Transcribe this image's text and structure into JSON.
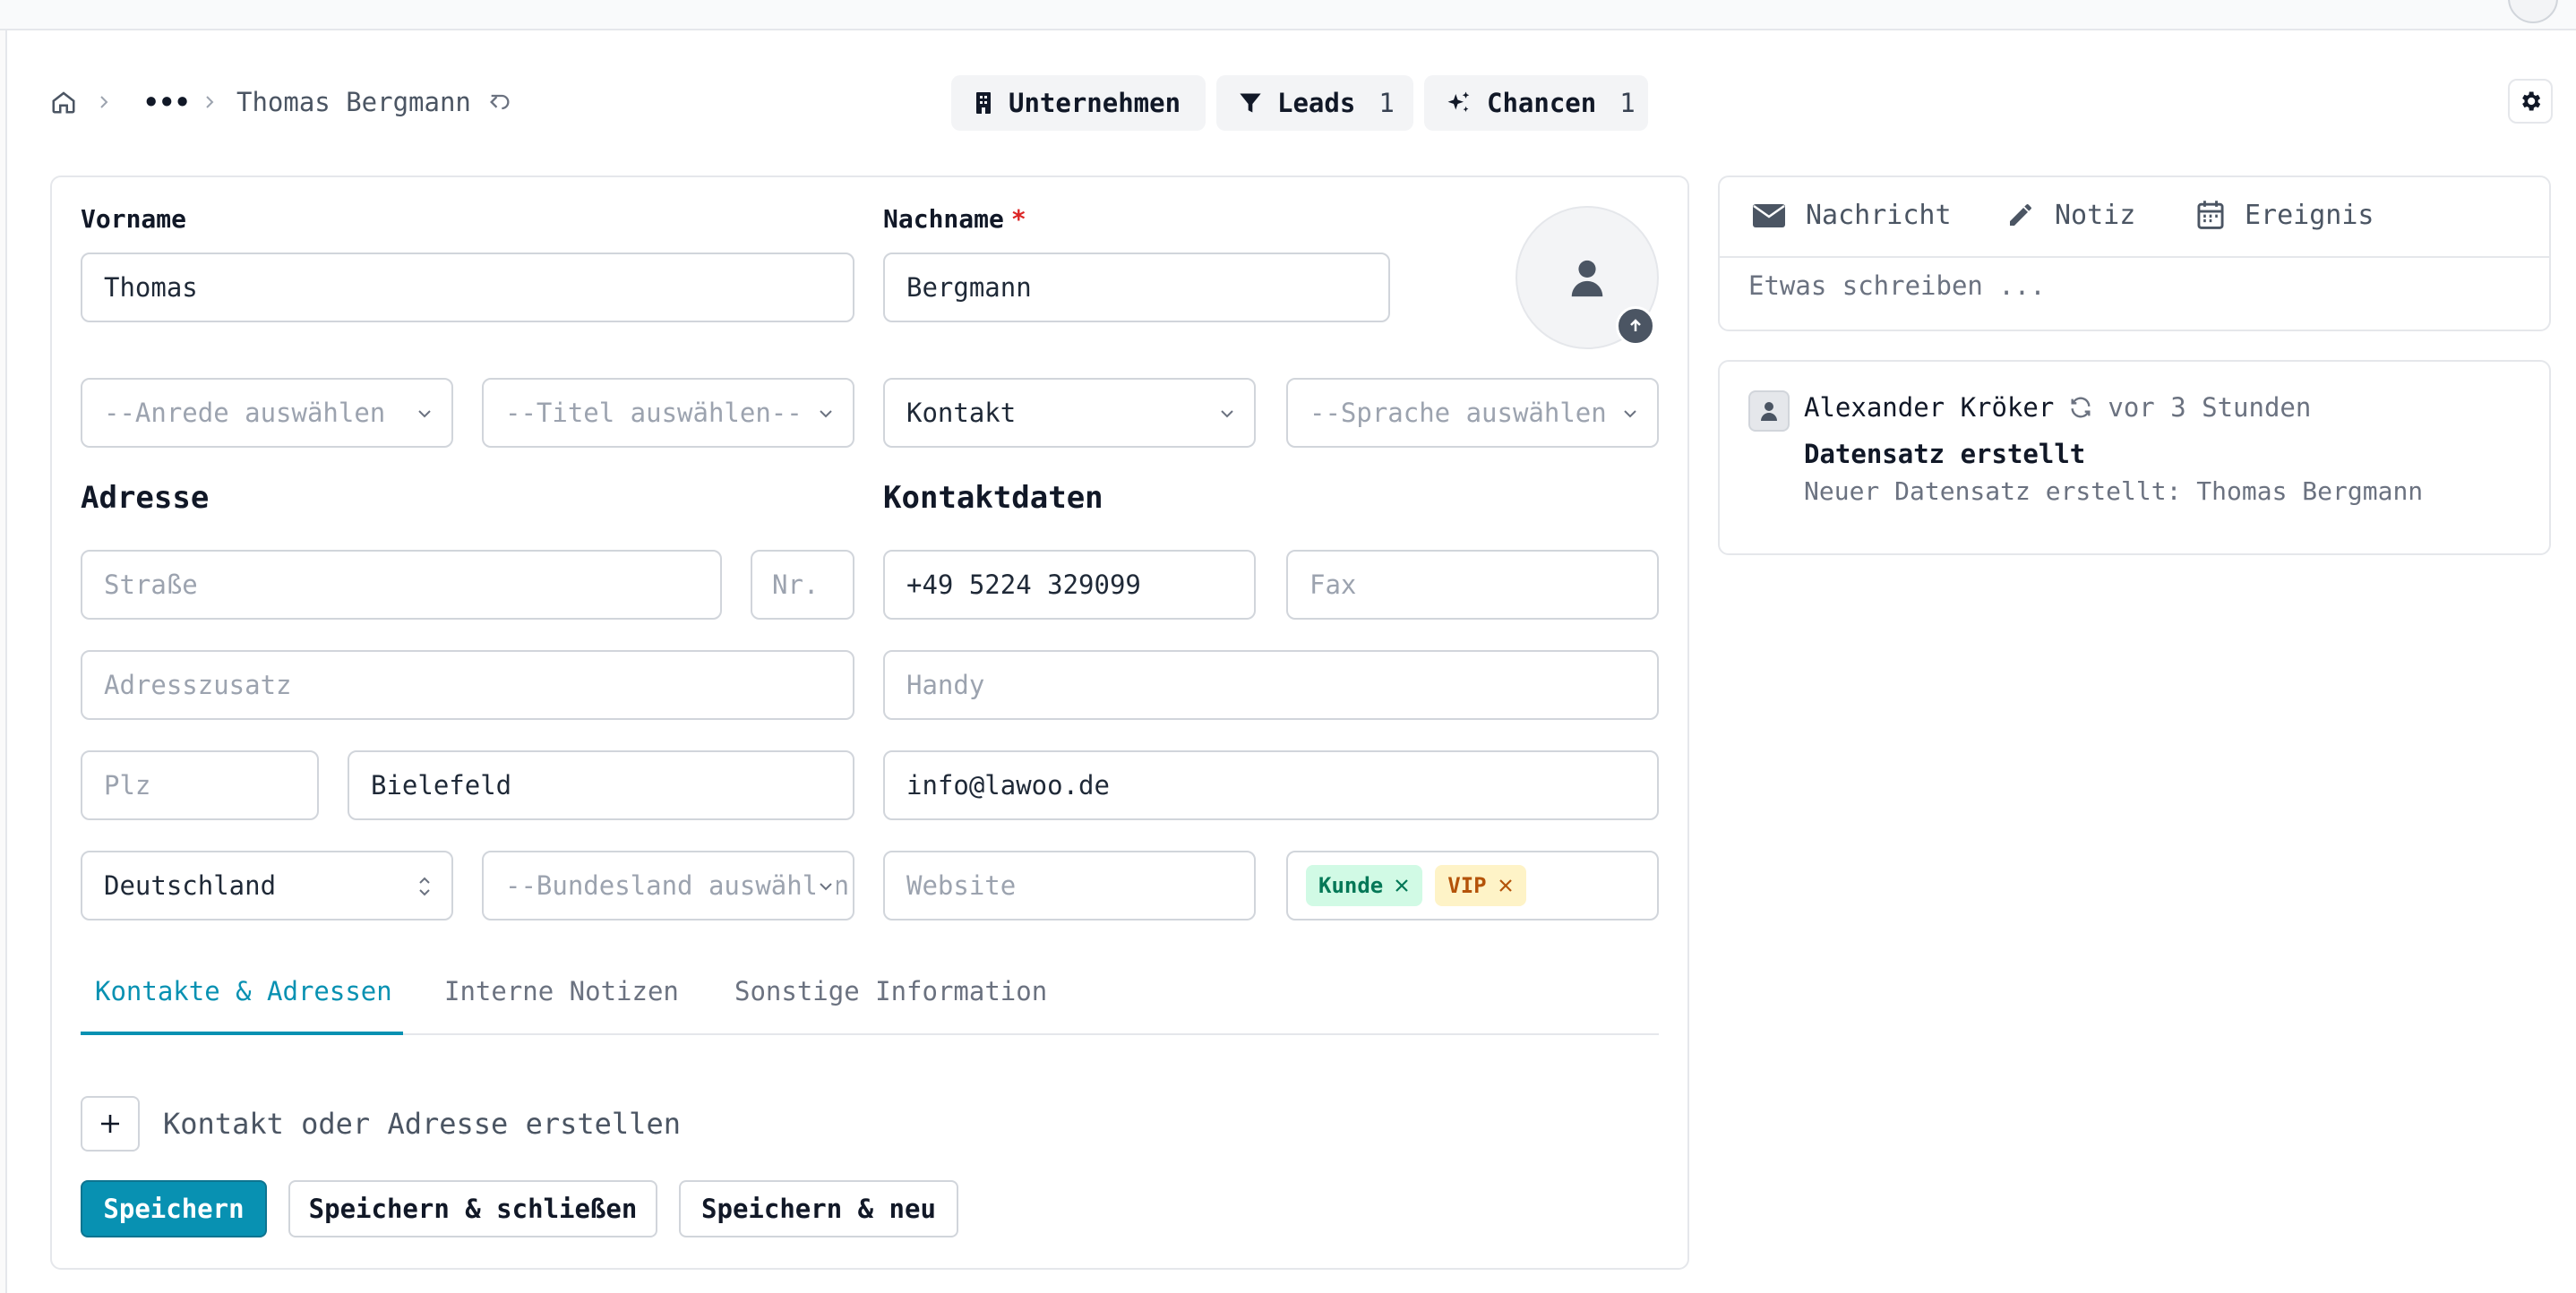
{
  "breadcrumb": {
    "more_label": "•••",
    "record_name": "Thomas Bergmann"
  },
  "top_actions": [
    {
      "label": "Unternehmen",
      "icon": "building-icon"
    },
    {
      "label": "Leads",
      "count": "1",
      "icon": "funnel-icon"
    },
    {
      "label": "Chancen",
      "count": "1",
      "icon": "sparkles-icon"
    }
  ],
  "form": {
    "first_name": {
      "label": "Vorname",
      "value": "Thomas"
    },
    "last_name": {
      "label": "Nachname",
      "required_mark": "*",
      "value": "Bergmann"
    },
    "salutation": {
      "placeholder": "--Anrede auswählen"
    },
    "title": {
      "placeholder": "--Titel auswählen--"
    },
    "type": {
      "value": "Kontakt"
    },
    "language": {
      "placeholder": "--Sprache auswählen"
    },
    "address_heading": "Adresse",
    "contact_heading": "Kontaktdaten",
    "street": {
      "placeholder": "Straße"
    },
    "number": {
      "placeholder": "Nr."
    },
    "address_extra": {
      "placeholder": "Adresszusatz"
    },
    "zip": {
      "placeholder": "Plz"
    },
    "city": {
      "value": "Bielefeld"
    },
    "country": {
      "value": "Deutschland"
    },
    "state": {
      "placeholder": "--Bundesland auswählen"
    },
    "phone": {
      "value": "+49 5224 329099"
    },
    "fax": {
      "placeholder": "Fax"
    },
    "mobile": {
      "placeholder": "Handy"
    },
    "email": {
      "value": "info@lawoo.de"
    },
    "website": {
      "placeholder": "Website"
    },
    "tags": [
      {
        "label": "Kunde",
        "color": "#047857"
      },
      {
        "label": "VIP",
        "color": "#b45309"
      }
    ]
  },
  "tabs": [
    {
      "label": "Kontakte & Adressen",
      "active": true
    },
    {
      "label": "Interne Notizen",
      "active": false
    },
    {
      "label": "Sonstige Information",
      "active": false
    }
  ],
  "add_contact_label": "Kontakt oder Adresse erstellen",
  "buttons": {
    "save": "Speichern",
    "save_close": "Speichern & schließen",
    "save_new": "Speichern & neu"
  },
  "chatter": {
    "tabs": [
      "Nachricht",
      "Notiz",
      "Ereignis"
    ],
    "input_placeholder": "Etwas schreiben ...",
    "entry": {
      "author": "Alexander Kröker",
      "time": "vor 3 Stunden",
      "title": "Datensatz erstellt",
      "body": "Neuer Datensatz erstellt: Thomas Bergmann"
    }
  },
  "colors": {
    "accent": "#0891b2",
    "required": "#dc2626"
  }
}
